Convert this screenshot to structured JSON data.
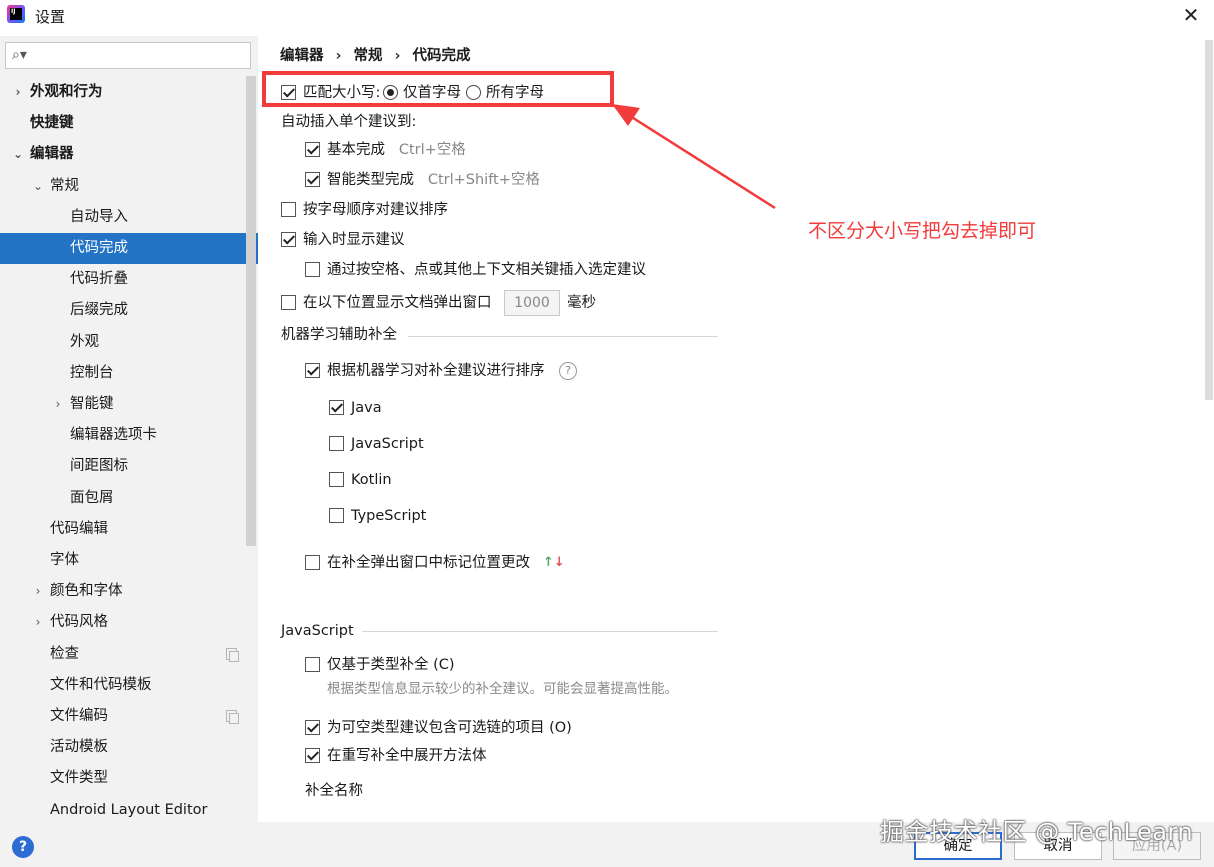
{
  "window": {
    "title": "设置",
    "logo_text": "IJ",
    "close_glyph": "✕"
  },
  "search": {
    "placeholder": "",
    "icon": "search-icon"
  },
  "sidebar": {
    "items": [
      {
        "label": "外观和行为",
        "bold": true,
        "arrow": "›"
      },
      {
        "label": "快捷键",
        "bold": true,
        "arrow": ""
      },
      {
        "label": "编辑器",
        "bold": true,
        "arrow": "⌄"
      },
      {
        "label": "常规",
        "bold": false,
        "arrow": "⌄"
      },
      {
        "label": "自动导入",
        "bold": false,
        "arrow": ""
      },
      {
        "label": "代码完成",
        "bold": false,
        "arrow": "",
        "selected": true
      },
      {
        "label": "代码折叠",
        "bold": false,
        "arrow": ""
      },
      {
        "label": "后缀完成",
        "bold": false,
        "arrow": ""
      },
      {
        "label": "外观",
        "bold": false,
        "arrow": ""
      },
      {
        "label": "控制台",
        "bold": false,
        "arrow": ""
      },
      {
        "label": "智能键",
        "bold": false,
        "arrow": "›"
      },
      {
        "label": "编辑器选项卡",
        "bold": false,
        "arrow": ""
      },
      {
        "label": "间距图标",
        "bold": false,
        "arrow": ""
      },
      {
        "label": "面包屑",
        "bold": false,
        "arrow": ""
      },
      {
        "label": "代码编辑",
        "bold": false,
        "arrow": ""
      },
      {
        "label": "字体",
        "bold": false,
        "arrow": ""
      },
      {
        "label": "颜色和字体",
        "bold": false,
        "arrow": "›"
      },
      {
        "label": "代码风格",
        "bold": false,
        "arrow": "›"
      },
      {
        "label": "检查",
        "bold": false,
        "arrow": "",
        "copy": true
      },
      {
        "label": "文件和代码模板",
        "bold": false,
        "arrow": ""
      },
      {
        "label": "文件编码",
        "bold": false,
        "arrow": "",
        "copy": true
      },
      {
        "label": "活动模板",
        "bold": false,
        "arrow": ""
      },
      {
        "label": "文件类型",
        "bold": false,
        "arrow": ""
      },
      {
        "label": "Android Layout Editor",
        "bold": false,
        "arrow": ""
      }
    ]
  },
  "breadcrumb": {
    "part1": "编辑器",
    "part2": "常规",
    "part3": "代码完成",
    "sep": "›"
  },
  "options": {
    "match_case": {
      "label": "匹配大小写:",
      "checked": true
    },
    "match_first_letter": {
      "label": "仅首字母",
      "selected": true
    },
    "match_all_letters": {
      "label": "所有字母",
      "selected": false
    },
    "auto_insert_heading": "自动插入单个建议到:",
    "basic_completion": {
      "label": "基本完成",
      "shortcut": "Ctrl+空格",
      "checked": true
    },
    "smart_completion": {
      "label": "智能类型完成",
      "shortcut": "Ctrl+Shift+空格",
      "checked": true
    },
    "sort_alpha": {
      "label": "按字母顺序对建议排序",
      "checked": false
    },
    "show_on_type": {
      "label": "输入时显示建议",
      "checked": true
    },
    "insert_on_space": {
      "label": "通过按空格、点或其他上下文相关键插入选定建议",
      "checked": false
    },
    "doc_popup": {
      "label": "在以下位置显示文档弹出窗口",
      "checked": false,
      "value": "1000",
      "unit": "毫秒"
    },
    "ml_section": "机器学习辅助补全",
    "ml_sort": {
      "label": "根据机器学习对补全建议进行排序",
      "checked": true
    },
    "ml_java": {
      "label": "Java",
      "checked": true
    },
    "ml_javascript": {
      "label": "JavaScript",
      "checked": false
    },
    "ml_kotlin": {
      "label": "Kotlin",
      "checked": false
    },
    "ml_typescript": {
      "label": "TypeScript",
      "checked": false
    },
    "mark_position": {
      "label": "在补全弹出窗口中标记位置更改",
      "checked": false,
      "arrow_up": "↑",
      "arrow_down": "↓"
    },
    "js_section": "JavaScript",
    "js_type_only": {
      "label": "仅基于类型补全 (C)",
      "checked": false,
      "hint": "根据类型信息显示较少的补全建议。可能会显著提高性能。"
    },
    "js_optional_chain": {
      "label": "为可空类型建议包含可选链的项目 (O)",
      "checked": true
    },
    "js_expand_methods": {
      "label": "在重写补全中展开方法体",
      "checked": true
    },
    "completion_names": "补全名称"
  },
  "annotation": {
    "text": "不区分大小写把勾去掉即可",
    "color": "#f23b3b"
  },
  "buttons": {
    "help": "?",
    "ok": "确定",
    "cancel": "取消",
    "apply": "应用(A)"
  },
  "watermark": "掘金技术社区 @ TechLearn"
}
